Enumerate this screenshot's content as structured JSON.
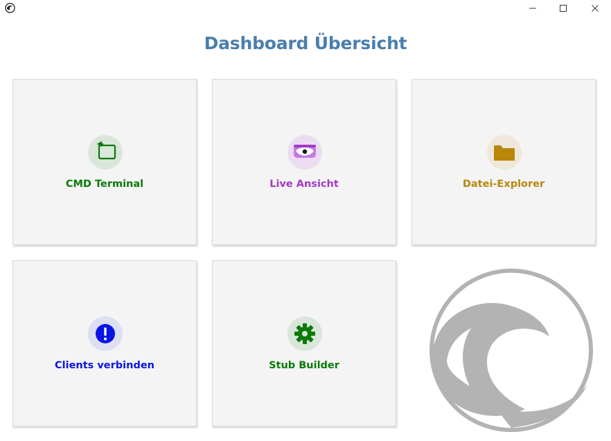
{
  "window": {
    "controls": [
      "minimize",
      "maximize",
      "close"
    ]
  },
  "heading": "Dashboard Übersicht",
  "tiles": [
    {
      "id": "cmd",
      "label": "CMD Terminal",
      "icon": "terminal-icon",
      "color": "#0a7a0a",
      "bg": "#dbe6db"
    },
    {
      "id": "live",
      "label": "Live Ansicht",
      "icon": "live-view-eye-icon",
      "color": "#a33ac6",
      "bg": "#ecdcf1"
    },
    {
      "id": "files",
      "label": "Datei-Explorer",
      "icon": "folder-icon",
      "color": "#b8860b",
      "bg": "#efe8da"
    },
    {
      "id": "clients",
      "label": "Clients verbinden",
      "icon": "exclamation-icon",
      "color": "#0a14e6",
      "bg": "#dddff2"
    },
    {
      "id": "stub",
      "label": "Stub Builder",
      "icon": "gear-icon",
      "color": "#0a7a0a",
      "bg": "#dbe6db"
    }
  ],
  "colors": {
    "heading": "#4a7fad",
    "logo": "#b3b3b3"
  }
}
